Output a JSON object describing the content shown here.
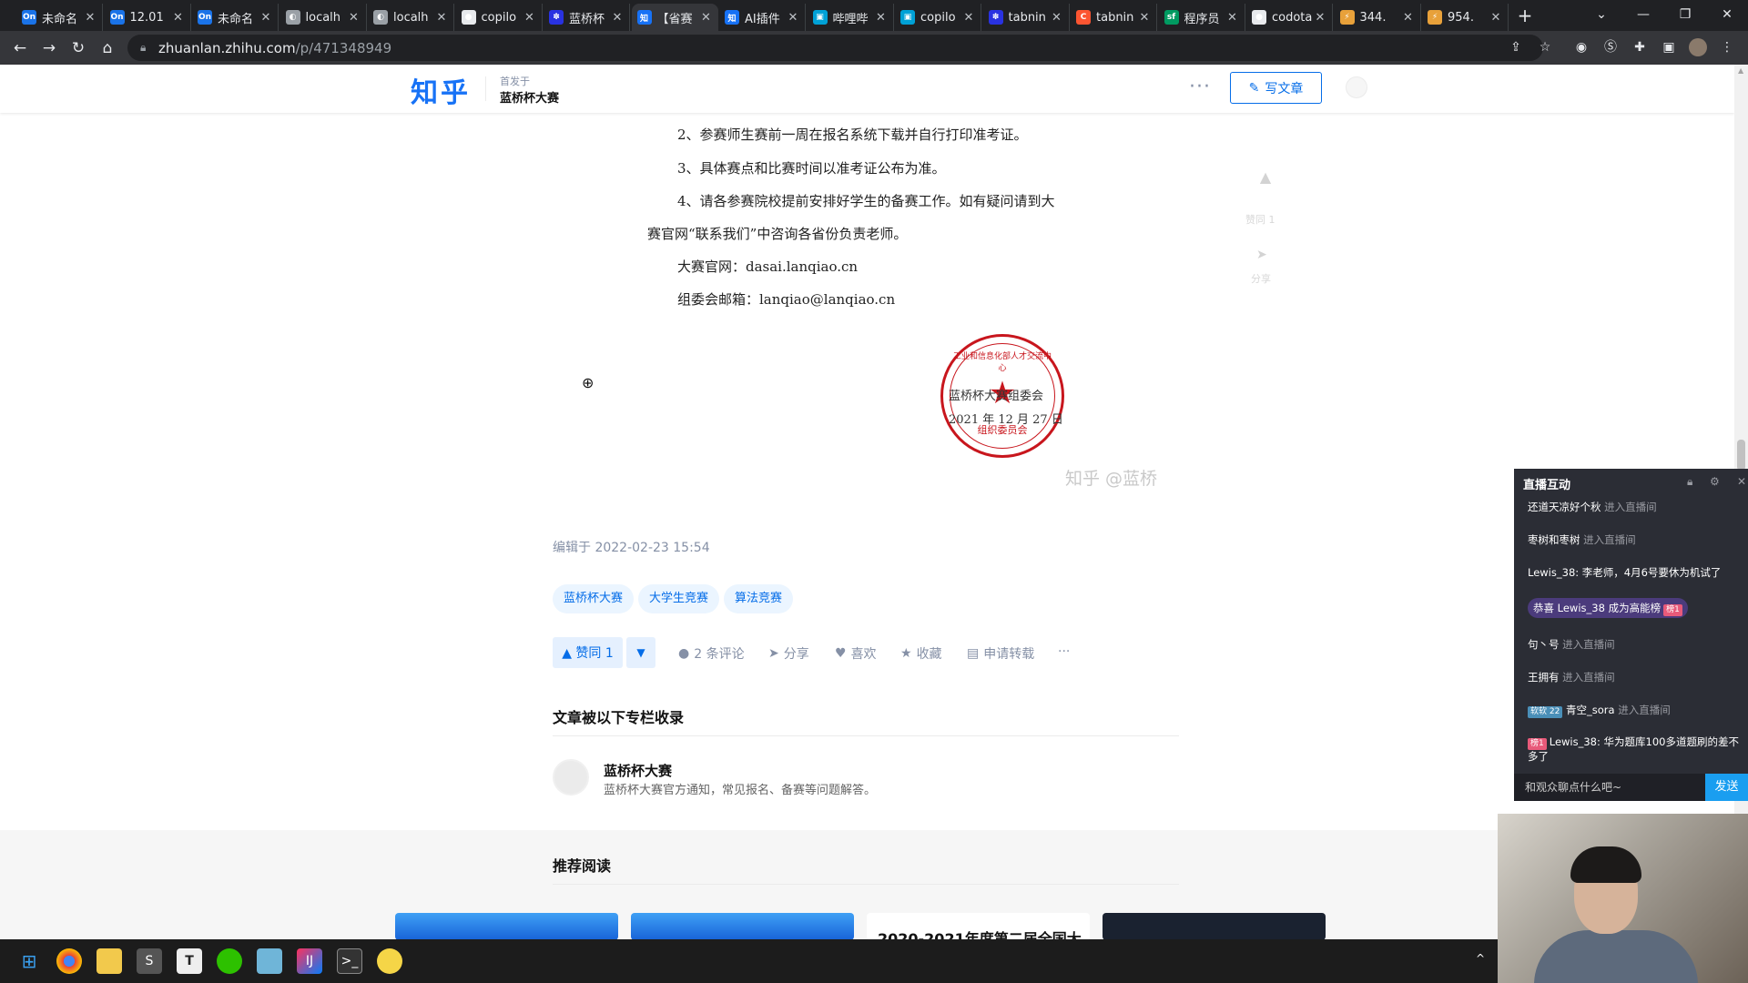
{
  "browser": {
    "tabs": [
      {
        "label": "未命名",
        "icon": "processon-icon",
        "color": "#1a73e8",
        "glyph": "On"
      },
      {
        "label": "12.01",
        "icon": "processon-icon",
        "color": "#1a73e8",
        "glyph": "On"
      },
      {
        "label": "未命名",
        "icon": "processon-icon",
        "color": "#1a73e8",
        "glyph": "On"
      },
      {
        "label": "localh",
        "icon": "globe-icon",
        "color": "#9aa0a6",
        "glyph": "◐"
      },
      {
        "label": "localh",
        "icon": "globe-icon",
        "color": "#9aa0a6",
        "glyph": "◐"
      },
      {
        "label": "copilo",
        "icon": "github-icon",
        "color": "#e8eaed",
        "glyph": "●"
      },
      {
        "label": "蓝桥杯",
        "icon": "baidu-icon",
        "color": "#2932e1",
        "glyph": "✽"
      },
      {
        "label": "【省赛",
        "icon": "zhihu-icon",
        "color": "#1772f6",
        "glyph": "知",
        "active": true
      },
      {
        "label": "AI插件",
        "icon": "zhihu-icon",
        "color": "#1772f6",
        "glyph": "知"
      },
      {
        "label": "哔哩哔",
        "icon": "bilibili-icon",
        "color": "#00a1d6",
        "glyph": "▣"
      },
      {
        "label": "copilo",
        "icon": "bilibili-icon",
        "color": "#00a1d6",
        "glyph": "▣"
      },
      {
        "label": "tabnin",
        "icon": "baidu-icon",
        "color": "#2932e1",
        "glyph": "✽"
      },
      {
        "label": "tabnin",
        "icon": "csdn-icon",
        "color": "#fc5531",
        "glyph": "C"
      },
      {
        "label": "程序员",
        "icon": "segmentfault-icon",
        "color": "#009a61",
        "glyph": "sf"
      },
      {
        "label": "codota",
        "icon": "github-icon",
        "color": "#e8eaed",
        "glyph": "●"
      },
      {
        "label": "344.",
        "icon": "juejin-icon",
        "color": "#e8a13a",
        "glyph": "⚡"
      },
      {
        "label": "954.",
        "icon": "juejin-icon",
        "color": "#e8a13a",
        "glyph": "⚡"
      }
    ],
    "url_host": "zhuanlan.zhihu.com",
    "url_path": "/p/471348949"
  },
  "header": {
    "logo": "知乎",
    "published_prefix": "首发于",
    "published_column": "蓝桥杯大赛",
    "more": "···",
    "write_label": "写文章"
  },
  "article": {
    "lines": [
      "2、参赛师生赛前一周在报名系统下载并自行打印准考证。",
      "3、具体赛点和比赛时间以准考证公布为准。",
      "4、请各参赛院校提前安排好学生的备赛工作。如有疑问请到大",
      "赛官网“联系我们”中咨询各省份负责老师。",
      "大赛官网：dasai.lanqiao.cn",
      "组委会邮箱：lanqiao@lanqiao.cn"
    ],
    "stamp_line1": "蓝桥杯大赛组委会",
    "stamp_line2": "2021 年 12 月 27 日",
    "stamp_ring": "工业和信息化部人才交流中心",
    "stamp_bottom": "组织委员会",
    "watermark": "知乎 @蓝桥",
    "side_like": "赞同 1",
    "side_share": "分享",
    "edited": "编辑于 2022-02-23 15:54",
    "tags": [
      "蓝桥杯大赛",
      "大学生竞赛",
      "算法竞赛"
    ],
    "vote_label": "▲ 赞同 1",
    "actions": {
      "comments": "2 条评论",
      "share": "分享",
      "like": "喜欢",
      "collect": "收藏",
      "reprint": "申请转载",
      "more": "···"
    },
    "collected_title": "文章被以下专栏收录",
    "column_name": "蓝桥杯大赛",
    "column_desc": "蓝桥杯大赛官方通知，常见报名、备赛等问题解答。",
    "recommend_title": "推荐阅读",
    "card3_title": "2020-2021年度第二届全国大"
  },
  "live": {
    "title": "直播互动",
    "messages": [
      {
        "user": "还道天凉好个秋",
        "text": "进入直播间"
      },
      {
        "user": "枣树和枣树",
        "text": "进入直播间"
      },
      {
        "user": "Lewis_38:",
        "text": "李老师，4月6号要休为机试了"
      },
      {
        "user": "句丶号",
        "text": "进入直播间"
      },
      {
        "user": "王拥有",
        "text": "进入直播间"
      },
      {
        "user": "青空_sora",
        "text": "进入直播间"
      },
      {
        "user": "Lewis_38:",
        "text": "华为题库100多道题刷的差不多了"
      }
    ],
    "congrats_pre": "恭喜",
    "congrats_user": "Lewis_38",
    "congrats_post": "成为高能榜",
    "rank_badge": "榜1",
    "fans_badge": "软软",
    "fans_level": "22",
    "input_placeholder": "和观众聊点什么吧~",
    "send": "发送"
  },
  "colors": {
    "zhihu_blue": "#056de8",
    "stamp_red": "#c8161d",
    "live_bg": "#2b2d35",
    "send_blue": "#1a9ef0"
  }
}
